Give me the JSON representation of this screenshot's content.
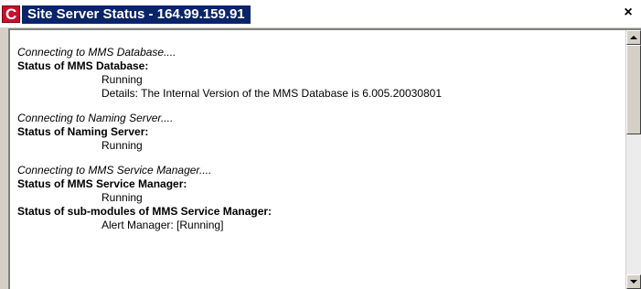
{
  "window": {
    "title": "Site Server Status - 164.99.159.91",
    "close_glyph": "×"
  },
  "log": {
    "mms_connecting": "Connecting to MMS Database....",
    "mms_status_heading": "Status of MMS Database:",
    "mms_status_value": "Running",
    "mms_details": "Details: The Internal Version of the MMS Database is 6.005.20030801",
    "naming_connecting": "Connecting to Naming Server....",
    "naming_status_heading": "Status of Naming Server:",
    "naming_status_value": "Running",
    "svc_connecting": "Connecting to MMS Service Manager....",
    "svc_status_heading": "Status of MMS Service Manager:",
    "svc_status_value": "Running",
    "submodules_heading": "Status of sub-modules of MMS Service Manager:",
    "submodule_partial": "Alert Manager: [Running]"
  },
  "icons": {
    "app_icon": "app-logo-icon",
    "scroll_up": "scroll-up-arrow-icon",
    "scroll_down": "scroll-down-arrow-icon"
  },
  "colors": {
    "title_highlight": "#0a246a",
    "app_icon_red": "#c8102e",
    "chrome": "#d4d0c8"
  }
}
